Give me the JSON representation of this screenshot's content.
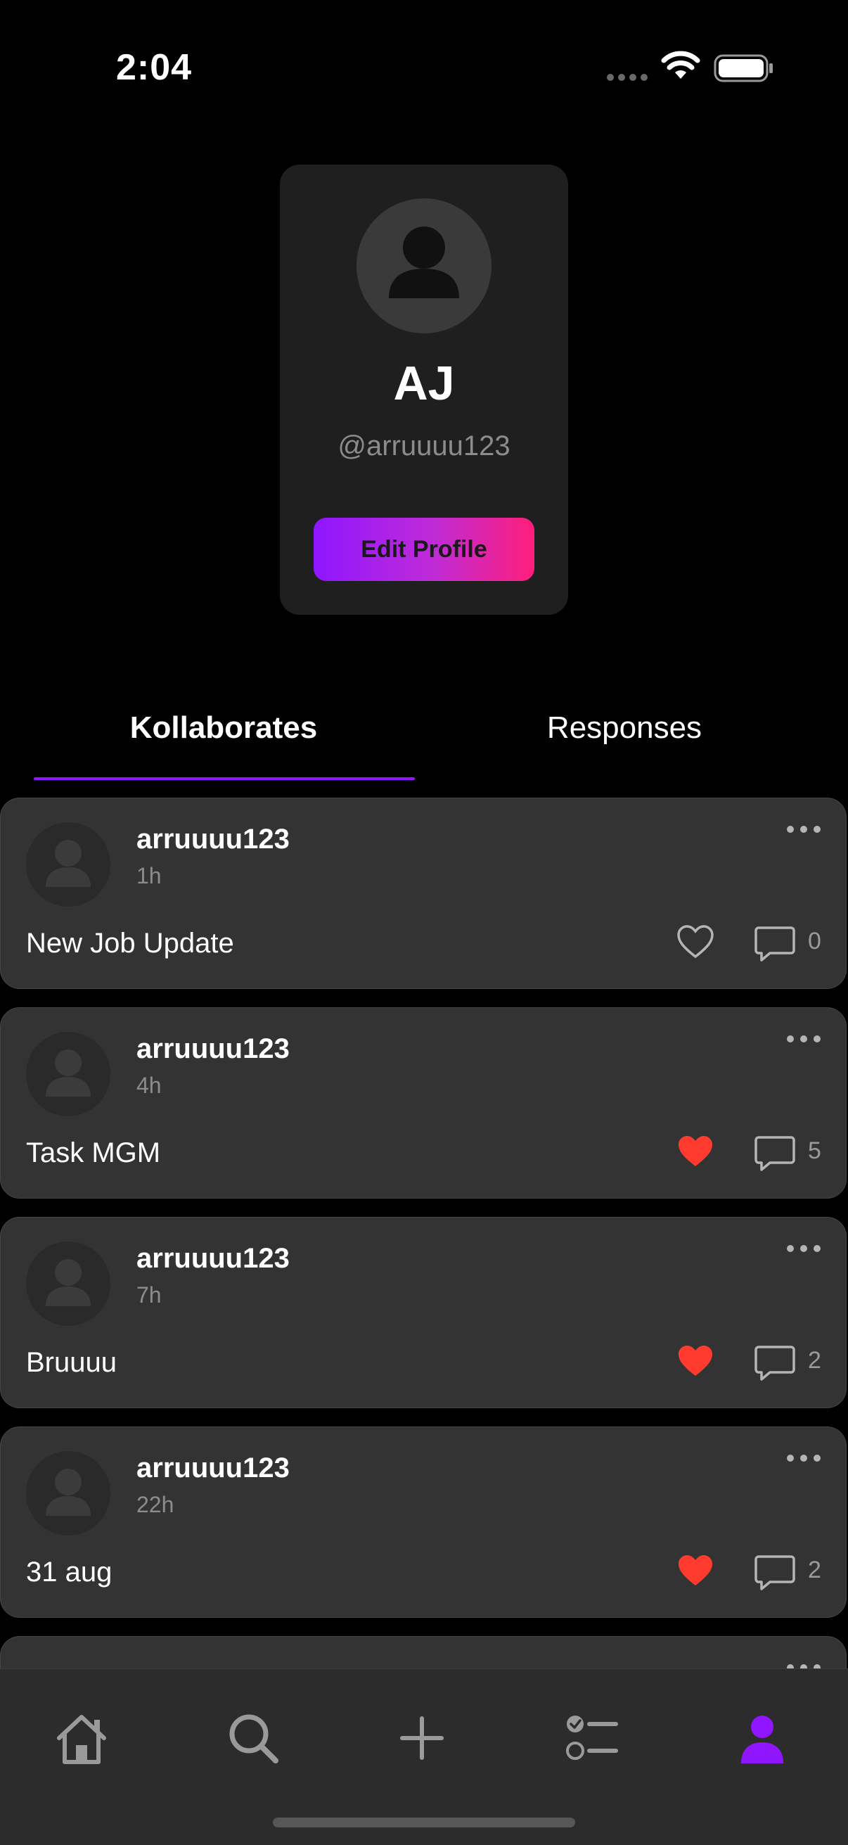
{
  "status_bar": {
    "time": "2:04",
    "icons": [
      "signal-dots-icon",
      "wifi-icon",
      "battery-icon"
    ]
  },
  "profile": {
    "name": "AJ",
    "handle": "@arruuuu123",
    "edit_button_label": "Edit Profile",
    "avatar_icon": "person-silhouette-icon"
  },
  "tabs": {
    "items": [
      {
        "label": "Kollaborates",
        "active": true
      },
      {
        "label": "Responses",
        "active": false
      }
    ]
  },
  "posts": [
    {
      "user": "arruuuu123",
      "time": "1h",
      "text": "New Job Update",
      "liked": false,
      "comments": "0"
    },
    {
      "user": "arruuuu123",
      "time": "4h",
      "text": "Task MGM",
      "liked": true,
      "comments": "5"
    },
    {
      "user": "arruuuu123",
      "time": "7h",
      "text": "Bruuuu",
      "liked": true,
      "comments": "2"
    },
    {
      "user": "arruuuu123",
      "time": "22h",
      "text": "31 aug",
      "liked": true,
      "comments": "2"
    },
    {
      "user": "",
      "time": "",
      "text": "",
      "liked": false,
      "comments": ""
    }
  ],
  "bottom_nav": {
    "items": [
      {
        "icon": "home-icon",
        "active": false
      },
      {
        "icon": "search-icon",
        "active": false
      },
      {
        "icon": "plus-icon",
        "active": false
      },
      {
        "icon": "tasks-list-icon",
        "active": false
      },
      {
        "icon": "profile-icon",
        "active": true
      }
    ]
  },
  "colors": {
    "background": "#000000",
    "card": "#333333",
    "profile_card": "#1f1f1f",
    "accent": "#8f16ff",
    "gradient_end": "#ff1e7a",
    "like_red": "#ff3b30",
    "muted_text": "#8c8c8c"
  }
}
